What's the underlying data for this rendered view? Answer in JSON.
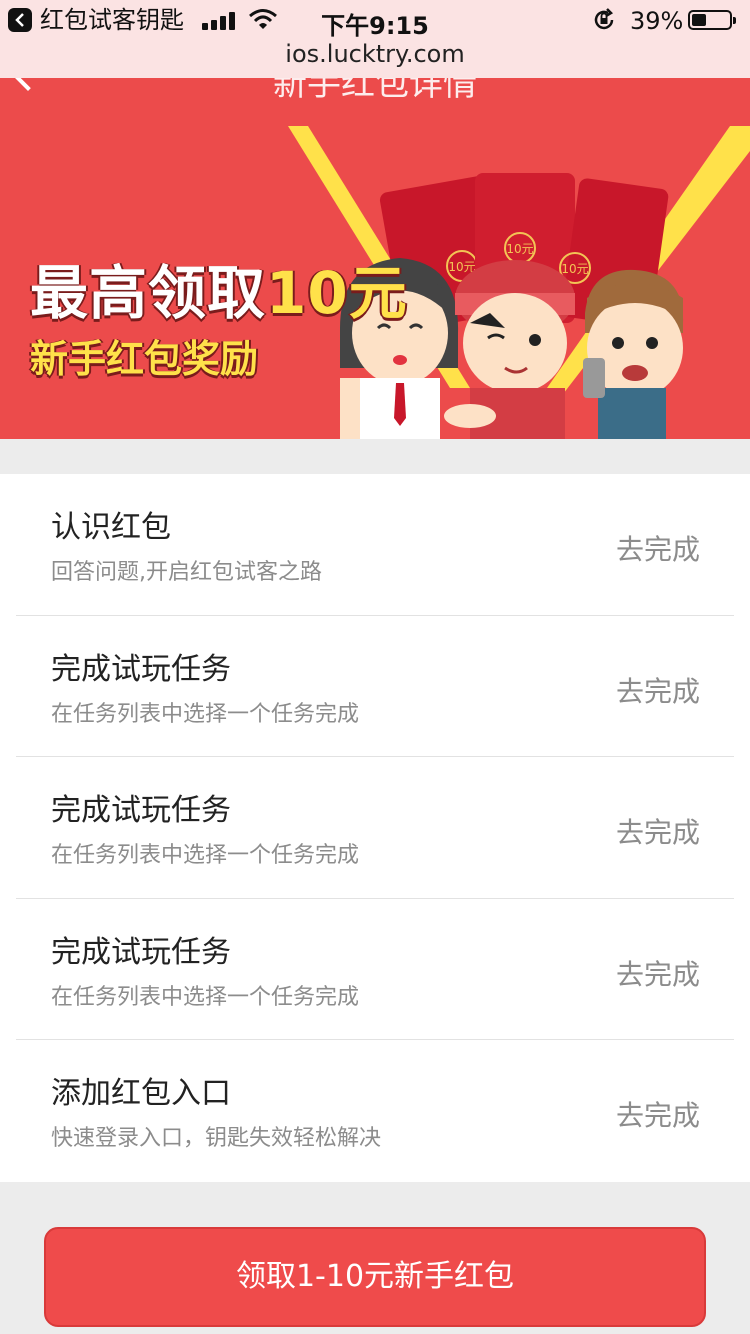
{
  "status_bar": {
    "back_app_label": "红包试客钥匙",
    "time": "下午9:15",
    "battery_percent": "39%",
    "battery_level": 0.39
  },
  "url_bar": {
    "url": "ios.lucktry.com"
  },
  "nav": {
    "title": "新手红包详情"
  },
  "banner": {
    "headline_prefix": "最高领取",
    "headline_amount": "10元",
    "subline": "新手红包奖励",
    "envelope_label": "10元",
    "colors": {
      "background": "#ec4b4b",
      "accent": "#ffe14a",
      "envelope": "#c8172a"
    }
  },
  "tasks": [
    {
      "title": "认识红包",
      "desc": "回答问题,开启红包试客之路",
      "action": "去完成"
    },
    {
      "title": "完成试玩任务",
      "desc": "在任务列表中选择一个任务完成",
      "action": "去完成"
    },
    {
      "title": "完成试玩任务",
      "desc": "在任务列表中选择一个任务完成",
      "action": "去完成"
    },
    {
      "title": "完成试玩任务",
      "desc": "在任务列表中选择一个任务完成",
      "action": "去完成"
    },
    {
      "title": "添加红包入口",
      "desc": "快速登录入口，钥匙失效轻松解决",
      "action": "去完成"
    }
  ],
  "claim_button": {
    "label": "领取1-10元新手红包",
    "color": "#ef4b4b"
  }
}
